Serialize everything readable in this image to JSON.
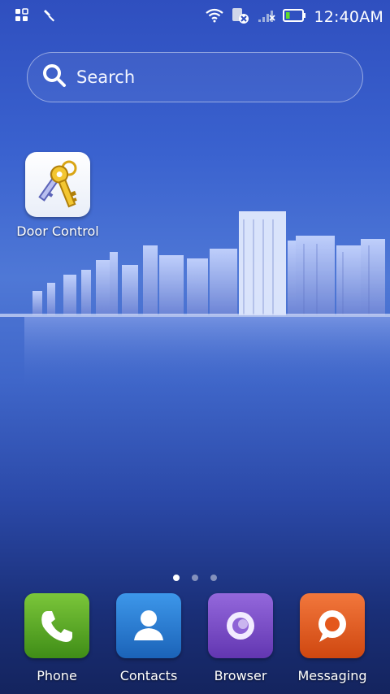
{
  "status_bar": {
    "time": "12:40AM",
    "icons": [
      "apps-grid-icon",
      "wrench-icon",
      "wifi-icon",
      "sim-blocked-icon",
      "no-signal-icon",
      "battery-icon"
    ],
    "battery_level": 0.25
  },
  "search": {
    "label": "Search",
    "icon": "search-icon"
  },
  "home_apps": [
    {
      "label": "Door Control",
      "icon": "keys-icon"
    }
  ],
  "page_indicator": {
    "count": 3,
    "active": 0
  },
  "dock": [
    {
      "label": "Phone",
      "icon": "phone-icon",
      "color": "#4f9d22"
    },
    {
      "label": "Contacts",
      "icon": "contact-icon",
      "color": "#1f78cf"
    },
    {
      "label": "Browser",
      "icon": "browser-icon",
      "color": "#7b4dc7"
    },
    {
      "label": "Messaging",
      "icon": "message-icon",
      "color": "#e4581c"
    }
  ]
}
